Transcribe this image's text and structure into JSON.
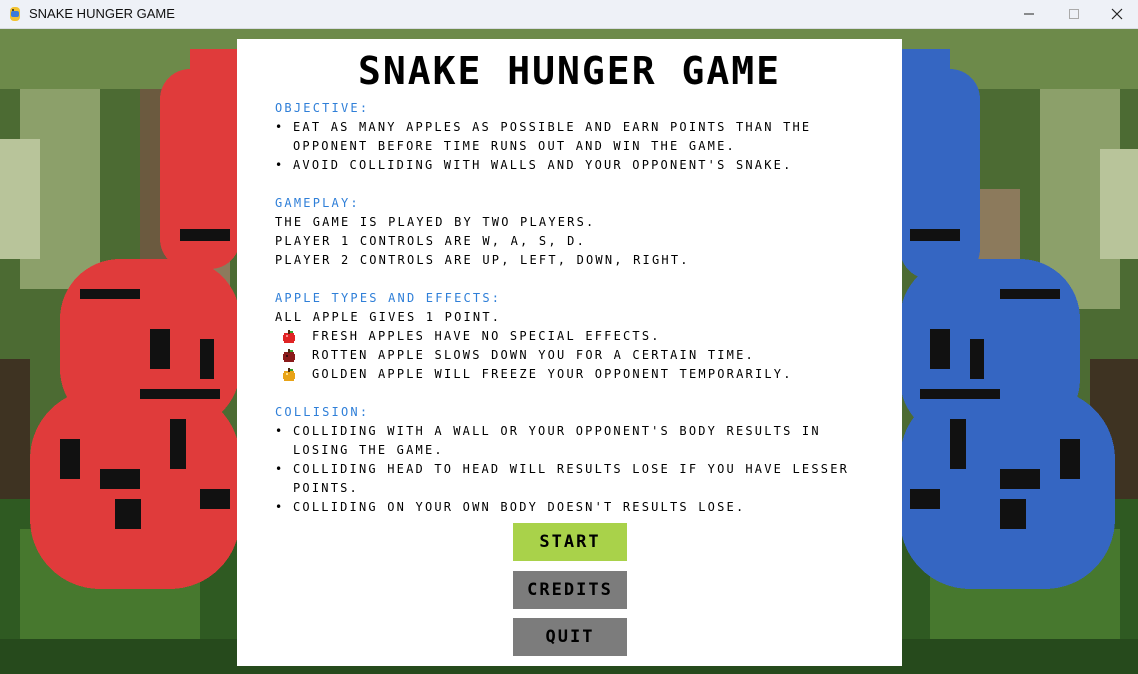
{
  "window": {
    "title": "SNAKE HUNGER GAME",
    "controls": [
      "minimize-icon",
      "maximize-icon",
      "close-icon"
    ]
  },
  "panel": {
    "title": "SNAKE HUNGER GAME",
    "objective": {
      "heading": "OBJECTIVE:",
      "lines": [
        "EAT AS MANY APPLES AS POSSIBLE AND EARN POINTS THAN THE",
        "OPPONENT BEFORE TIME RUNS OUT AND WIN THE GAME.",
        "AVOID COLLIDING WITH WALLS AND YOUR OPPONENT'S SNAKE."
      ]
    },
    "gameplay": {
      "heading": "GAMEPLAY:",
      "lines": [
        "THE GAME IS PLAYED BY TWO PLAYERS.",
        "PLAYER 1 CONTROLS ARE W, A, S, D.",
        "PLAYER 2 CONTROLS ARE UP, LEFT, DOWN, RIGHT."
      ]
    },
    "apples": {
      "heading": "APPLE TYPES AND EFFECTS:",
      "intro": "ALL APPLE GIVES 1 POINT.",
      "items": [
        {
          "icon": "fresh-apple-icon",
          "text": "FRESH APPLES HAVE NO SPECIAL EFFECTS.",
          "color": "#e02424"
        },
        {
          "icon": "rotten-apple-icon",
          "text": "ROTTEN APPLE SLOWS DOWN YOU FOR A CERTAIN TIME.",
          "color": "#8a1a1a"
        },
        {
          "icon": "golden-apple-icon",
          "text": "GOLDEN APPLE WILL FREEZE YOUR OPPONENT TEMPORARILY.",
          "color": "#e8a317"
        }
      ]
    },
    "collision": {
      "heading": "COLLISION:",
      "lines": [
        "COLLIDING WITH A WALL OR YOUR OPPONENT'S BODY RESULTS IN",
        "LOSING THE GAME.",
        "COLLIDING HEAD TO HEAD WILL RESULTS LOSE IF YOU HAVE LESSER",
        "POINTS.",
        "COLLIDING ON YOUR OWN BODY DOESN'T RESULTS LOSE."
      ]
    },
    "buttons": {
      "start": "START",
      "credits": "CREDITS",
      "quit": "QUIT"
    }
  },
  "colors": {
    "heading": "#2f7fd8",
    "start_button": "#a9d24a",
    "gray_button": "#7c7c7c",
    "red_snake": "#e03b3b",
    "blue_snake": "#3566c2"
  }
}
